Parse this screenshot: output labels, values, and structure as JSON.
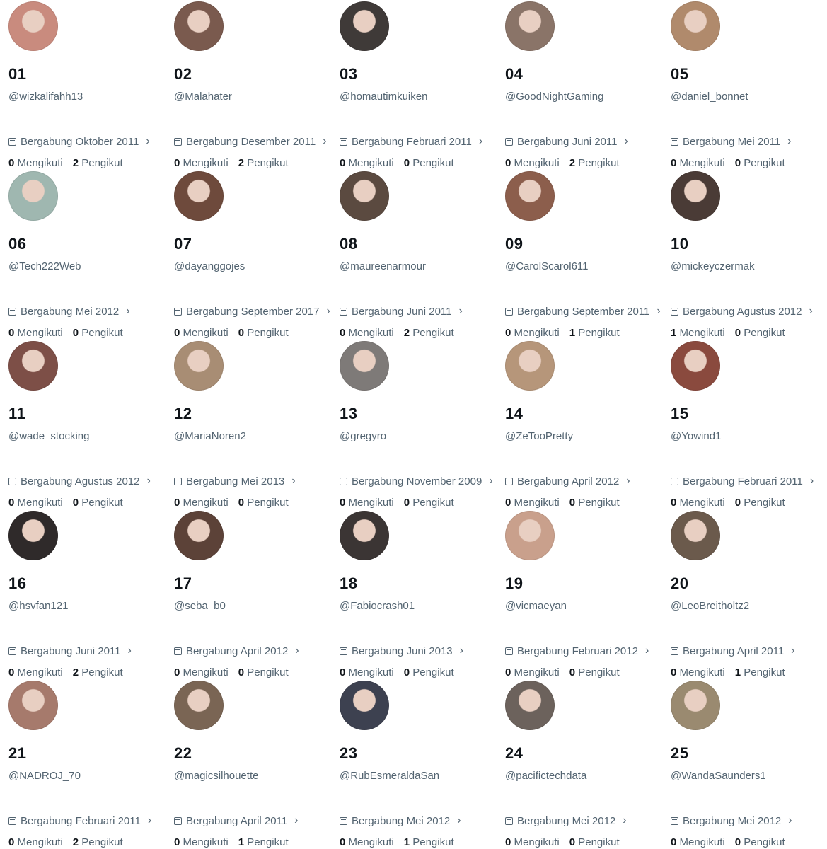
{
  "labels": {
    "following": "Mengikuti",
    "followers": "Pengikut"
  },
  "icons": {
    "calendar": "calendar-icon",
    "chevron": "chevron-right-icon"
  },
  "accounts": [
    {
      "num": "01",
      "handle": "@wizkalifahh13",
      "joined": "Bergabung Oktober 2011",
      "following": "0",
      "followers": "2",
      "avatar": "#c98b7e"
    },
    {
      "num": "02",
      "handle": "@Malahater",
      "joined": "Bergabung Desember 2011",
      "following": "0",
      "followers": "2",
      "avatar": "#7a5a4e"
    },
    {
      "num": "03",
      "handle": "@homautimkuiken",
      "joined": "Bergabung Februari 2011",
      "following": "0",
      "followers": "0",
      "avatar": "#3f3a38"
    },
    {
      "num": "04",
      "handle": "@GoodNightGaming",
      "joined": "Bergabung Juni 2011",
      "following": "0",
      "followers": "2",
      "avatar": "#8a7468"
    },
    {
      "num": "05",
      "handle": "@daniel_bonnet",
      "joined": "Bergabung Mei 2011",
      "following": "0",
      "followers": "0",
      "avatar": "#b08a6c"
    },
    {
      "num": "06",
      "handle": "@Tech222Web",
      "joined": "Bergabung Mei 2012",
      "following": "0",
      "followers": "0",
      "avatar": "#9fb7b0"
    },
    {
      "num": "07",
      "handle": "@dayanggojes",
      "joined": "Bergabung September 2017",
      "following": "0",
      "followers": "0",
      "avatar": "#6e4a3c"
    },
    {
      "num": "08",
      "handle": "@maureenarmour",
      "joined": "Bergabung Juni 2011",
      "following": "0",
      "followers": "2",
      "avatar": "#5b4a40"
    },
    {
      "num": "09",
      "handle": "@CarolScarol611",
      "joined": "Bergabung September 2011",
      "following": "0",
      "followers": "1",
      "avatar": "#8c5e4c"
    },
    {
      "num": "10",
      "handle": "@mickeyczermak",
      "joined": "Bergabung Agustus 2012",
      "following": "1",
      "followers": "0",
      "avatar": "#4a3b36"
    },
    {
      "num": "11",
      "handle": "@wade_stocking",
      "joined": "Bergabung Agustus 2012",
      "following": "0",
      "followers": "0",
      "avatar": "#7d4f47"
    },
    {
      "num": "12",
      "handle": "@MariaNoren2",
      "joined": "Bergabung Mei 2013",
      "following": "0",
      "followers": "0",
      "avatar": "#a88d74"
    },
    {
      "num": "13",
      "handle": "@gregyro",
      "joined": "Bergabung November 2009",
      "following": "0",
      "followers": "0",
      "avatar": "#7e7a78"
    },
    {
      "num": "14",
      "handle": "@ZeTooPretty",
      "joined": "Bergabung April 2012",
      "following": "0",
      "followers": "0",
      "avatar": "#b6967a"
    },
    {
      "num": "15",
      "handle": "@Yowind1",
      "joined": "Bergabung Februari 2011",
      "following": "0",
      "followers": "0",
      "avatar": "#8a4a3e"
    },
    {
      "num": "16",
      "handle": "@hsvfan121",
      "joined": "Bergabung Juni 2011",
      "following": "0",
      "followers": "2",
      "avatar": "#2f2a2a"
    },
    {
      "num": "17",
      "handle": "@seba_b0",
      "joined": "Bergabung April 2012",
      "following": "0",
      "followers": "0",
      "avatar": "#5c4238"
    },
    {
      "num": "18",
      "handle": "@Fabiocrash01",
      "joined": "Bergabung Juni 2013",
      "following": "0",
      "followers": "0",
      "avatar": "#3b3534"
    },
    {
      "num": "19",
      "handle": "@vicmaeyan",
      "joined": "Bergabung Februari 2012",
      "following": "0",
      "followers": "0",
      "avatar": "#c9a08c"
    },
    {
      "num": "20",
      "handle": "@LeoBreitholtz2",
      "joined": "Bergabung April 2011",
      "following": "0",
      "followers": "1",
      "avatar": "#6b5a4c"
    },
    {
      "num": "21",
      "handle": "@NADROJ_70",
      "joined": "Bergabung Februari 2011",
      "following": "0",
      "followers": "2",
      "avatar": "#a67a6c"
    },
    {
      "num": "22",
      "handle": "@magicsilhouette",
      "joined": "Bergabung April 2011",
      "following": "0",
      "followers": "1",
      "avatar": "#7a6554"
    },
    {
      "num": "23",
      "handle": "@RubEsmeraldaSan",
      "joined": "Bergabung Mei 2012",
      "following": "0",
      "followers": "1",
      "avatar": "#3d4150"
    },
    {
      "num": "24",
      "handle": "@pacifictechdata",
      "joined": "Bergabung Mei 2012",
      "following": "0",
      "followers": "0",
      "avatar": "#6c625c"
    },
    {
      "num": "25",
      "handle": "@WandaSaunders1",
      "joined": "Bergabung Mei 2012",
      "following": "0",
      "followers": "0",
      "avatar": "#9a8a70"
    }
  ]
}
